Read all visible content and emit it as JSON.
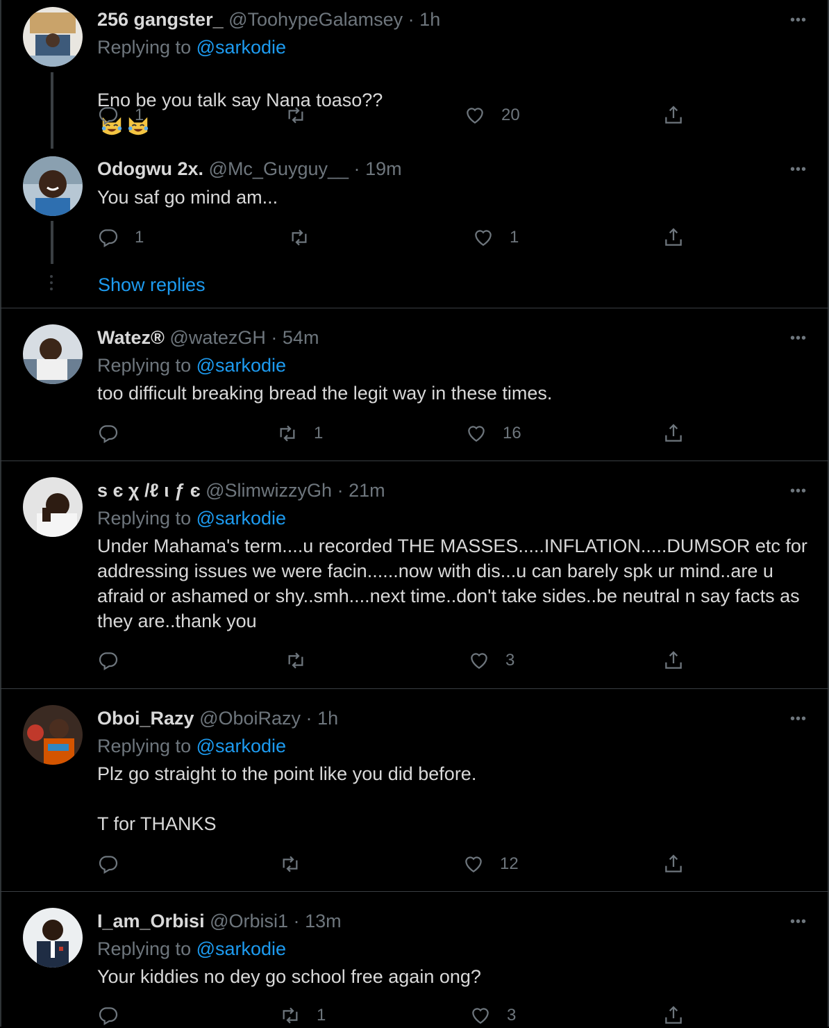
{
  "tweets": [
    {
      "name": "256 gangster_",
      "handle": "@ToohypeGalamsey",
      "sep": "·",
      "time": "1h",
      "replying_prefix": "Replying to",
      "replying_to": "@sarkodie",
      "text": "Eno be you talk say Nana toaso??",
      "emoji": [
        "cat-with-tears-of-joy",
        "cat-with-tears-of-joy"
      ],
      "replies": "1",
      "retweets": "",
      "likes": "20"
    },
    {
      "name": "Odogwu 2x.",
      "handle": "@Mc_Guyguy__",
      "sep": "·",
      "time": "19m",
      "text": "You saf go mind am...",
      "replies": "1",
      "retweets": "",
      "likes": "1"
    },
    {
      "name": "Watez®",
      "handle": "@watezGH",
      "sep": "·",
      "time": "54m",
      "replying_prefix": "Replying to",
      "replying_to": "@sarkodie",
      "text": "too difficult breaking bread the legit way in these times.",
      "replies": "",
      "retweets": "1",
      "likes": "16"
    },
    {
      "name": "s є χ /ℓ ι ƒ є",
      "handle": "@SlimwizzyGh",
      "sep": "·",
      "time": "21m",
      "replying_prefix": "Replying to",
      "replying_to": "@sarkodie",
      "text": "Under Mahama's term....u recorded THE MASSES.....INFLATION.....DUMSOR etc for addressing issues we were facin......now with dis...u can barely spk ur mind..are u afraid or ashamed or shy..smh....next time..don't take sides..be neutral n say facts as they are..thank you",
      "replies": "",
      "retweets": "",
      "likes": "3"
    },
    {
      "name": "Oboi_Razy",
      "handle": "@OboiRazy",
      "sep": "·",
      "time": "1h",
      "replying_prefix": "Replying to",
      "replying_to": "@sarkodie",
      "text": "Plz go straight to the point like you did before.\n\nT for THANKS",
      "replies": "",
      "retweets": "",
      "likes": "12"
    },
    {
      "name": "I_am_Orbisi",
      "handle": "@Orbisi1",
      "sep": "·",
      "time": "13m",
      "replying_prefix": "Replying to",
      "replying_to": "@sarkodie",
      "text": "Your kiddies no dey go school free again ong?",
      "replies": "",
      "retweets": "1",
      "likes": "3"
    }
  ],
  "show_replies": "Show replies",
  "more_label": "•••",
  "icons": {
    "reply": "reply-icon",
    "retweet": "retweet-icon",
    "like": "like-icon",
    "share": "share-icon"
  },
  "colors": {
    "background": "#000000",
    "text": "#d9d9d9",
    "muted": "#6e767d",
    "link": "#1d9bf0",
    "divider": "#3a3f43"
  }
}
